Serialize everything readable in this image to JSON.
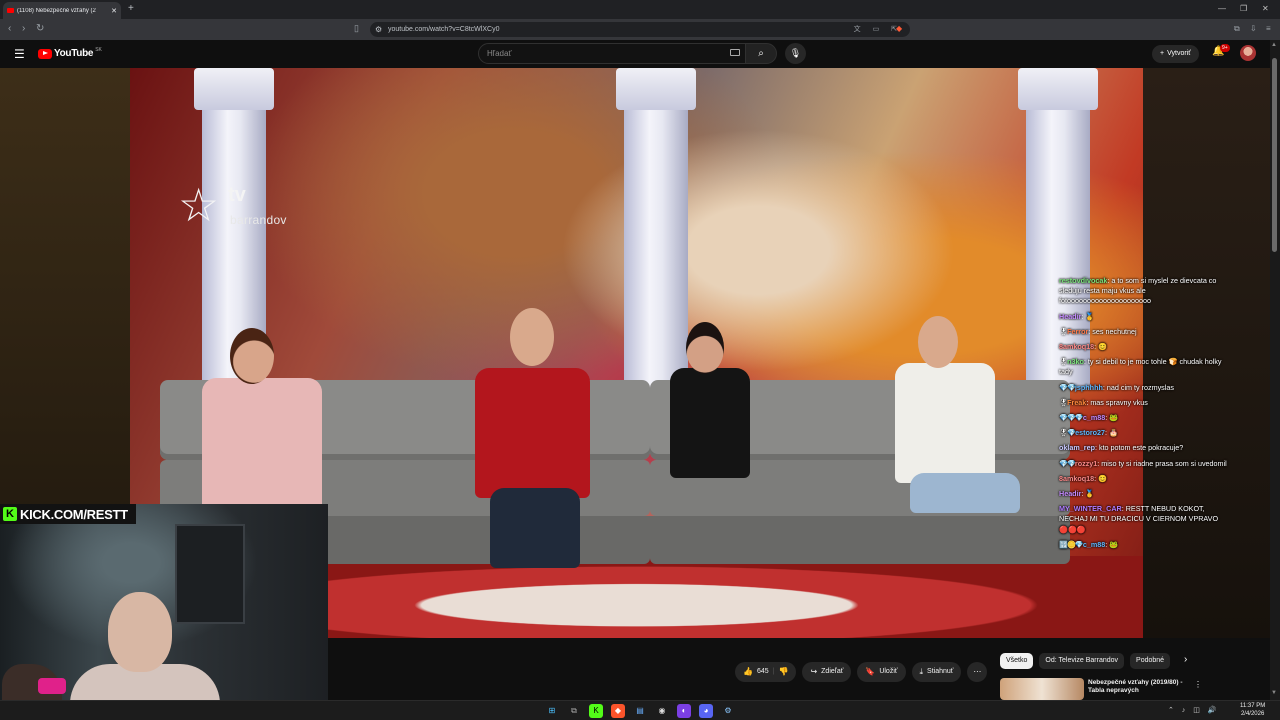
{
  "browser": {
    "tab_title": "(1108) Nebezpečné vzťahy (2",
    "url": "youtube.com/watch?v=C8tcWlXCy0"
  },
  "youtube": {
    "logo_text": "YouTube",
    "country_code": "SK",
    "search_placeholder": "Hľadať",
    "create_label": "Vytvoriť",
    "notification_count": "9+"
  },
  "video": {
    "channel_logo_top": "tv",
    "channel_logo_bottom": "barrandov",
    "stream_url_overlay": "KICK.COM/RESTT",
    "kick_badge": "K"
  },
  "chat": [
    {
      "user": "restovdivocak",
      "color": "#7be37b",
      "badges": "",
      "message": "a to som si myslel ze dievcata co sleduju resta maju vkus ale fotooooooooooooooooooooo"
    },
    {
      "user": "Headir",
      "color": "#c58bff",
      "badges": "",
      "message": "🥇"
    },
    {
      "user": "Ferror",
      "color": "#ff7a4a",
      "badges": "🎖",
      "message": "ses nechutnej"
    },
    {
      "user": "8amkoq18",
      "color": "#ff8a8a",
      "badges": "",
      "message": "😊"
    },
    {
      "user": "n3ko",
      "color": "#7be37b",
      "badges": "🎖",
      "message": "ty si debil to je moc tohle 🍞 chudak holky tady"
    },
    {
      "user": "jsphhhh",
      "color": "#5fb8ff",
      "badges": "💎💎",
      "message": "nad cim ty rozmyslas"
    },
    {
      "user": "Freak",
      "color": "#ff8a3d",
      "badges": "🎖",
      "message": "mas spravny vkus"
    },
    {
      "user": "c_m88",
      "color": "#c58bff",
      "badges": "💎💎💎",
      "message": "🐸"
    },
    {
      "user": "estoro27",
      "color": "#5fb8ff",
      "badges": "🎖💎",
      "message": "🎂"
    },
    {
      "user": "oklam_rep",
      "color": "#c8c8ff",
      "badges": "",
      "message": "kto potom este pokracuje?"
    },
    {
      "user": "rozzy1",
      "color": "#ff8a8a",
      "badges": "💎💎",
      "message": "miso ty si riadne prasa som si uvedomil"
    },
    {
      "user": "8amkoq18",
      "color": "#ff8a8a",
      "badges": "",
      "message": "😊"
    },
    {
      "user": "Headir",
      "color": "#c58bff",
      "badges": "",
      "message": "🥇"
    },
    {
      "user": "MY_WINTER_CAR",
      "color": "#b07bff",
      "badges": "",
      "message": "RESTT NEBUD KOKOT, NECHAJ MI TU DRACICU V CIERNOM VPRAVO 🔴🔴🔴"
    },
    {
      "user": "c_m88",
      "color": "#5fb8ff",
      "badges": "🔢🪙💎",
      "message": "🐸"
    }
  ],
  "actions": {
    "like_count": "645",
    "share_label": "Zdieľať",
    "save_label": "Uložiť",
    "download_label": "Stiahnuť"
  },
  "filters": [
    "Všetko",
    "Od: Televize Barrandov",
    "Podobné"
  ],
  "related": {
    "title": "Nebezpečné vzťahy (2019/80) - Tabla nepravých"
  },
  "taskbar": {
    "time": "11:37 PM",
    "date": "2/4/2026"
  }
}
